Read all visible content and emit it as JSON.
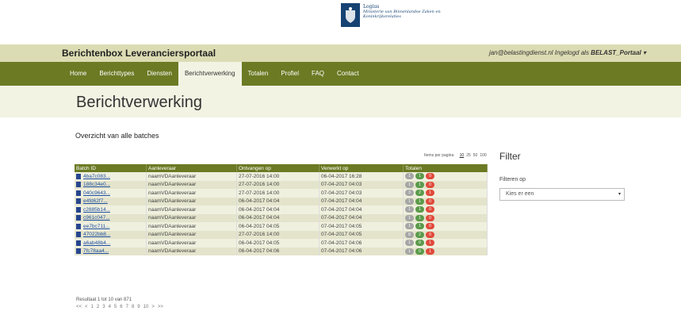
{
  "logo": {
    "line1": "Logius",
    "line2": "Ministerie van Binnenlandse Zaken en",
    "line3": "Koninkrijksrelaties"
  },
  "header": {
    "site_title": "Berichtenbox Leveranciersportaal",
    "user_email": "jan@belastingdienst.nl Ingelogd als ",
    "user_account": "BELAST_Portaal",
    "dropdown_caret": "▾"
  },
  "nav": {
    "items": [
      "Home",
      "Berichttypes",
      "Diensten",
      "Berichtverwerking",
      "Totalen",
      "Profiel",
      "FAQ",
      "Contact"
    ],
    "active": "Berichtverwerking"
  },
  "page": {
    "title": "Berichtverwerking",
    "subtitle": "Overzicht van alle batches"
  },
  "per_page": {
    "label": "Items per pagina",
    "options": [
      "10",
      "25",
      "50",
      "100"
    ],
    "selected": "10"
  },
  "table": {
    "columns": [
      "Batch ID",
      "Aanleveraar",
      "Ontvangen op",
      "Verwerkt op",
      "Totalen"
    ],
    "rows": [
      {
        "id": "4ba7c083...",
        "aanleveraar": "naamVDAanleveraar",
        "ontvangen": "27-07-2016 14:00",
        "verwerkt": "06-04-2017 16:28",
        "t": [
          "1",
          "1",
          "0"
        ]
      },
      {
        "id": "188c34e0...",
        "aanleveraar": "naamVDAanleveraar",
        "ontvangen": "27-07-2016 14:00",
        "verwerkt": "07-04-2017 04:03",
        "t": [
          "1",
          "1",
          "0"
        ]
      },
      {
        "id": "040c9643...",
        "aanleveraar": "naamVDAanleveraar",
        "ontvangen": "27-07-2016 14:00",
        "verwerkt": "07-04-2017 04:03",
        "t": [
          "3",
          "2",
          "1"
        ]
      },
      {
        "id": "e4fd62f7...",
        "aanleveraar": "naamVDAanleveraar",
        "ontvangen": "06-04-2017 04:04",
        "verwerkt": "07-04-2017 04:04",
        "t": [
          "1",
          "1",
          "0"
        ]
      },
      {
        "id": "c2885b14...",
        "aanleveraar": "naamVDAanleveraar",
        "ontvangen": "06-04-2017 04:04",
        "verwerkt": "07-04-2017 04:04",
        "t": [
          "1",
          "1",
          "0"
        ]
      },
      {
        "id": "c961c047...",
        "aanleveraar": "naamVDAanleveraar",
        "ontvangen": "06-04-2017 04:04",
        "verwerkt": "07-04-2017 04:04",
        "t": [
          "1",
          "1",
          "0"
        ]
      },
      {
        "id": "ee7bc711...",
        "aanleveraar": "naamVDAanleveraar",
        "ontvangen": "06-04-2017 04:05",
        "verwerkt": "07-04-2017 04:05",
        "t": [
          "1",
          "1",
          "0"
        ]
      },
      {
        "id": "47022bb8...",
        "aanleveraar": "naamVDAanleveraar",
        "ontvangen": "27-07-2016 14:00",
        "verwerkt": "07-04-2017 04:05",
        "t": [
          "8",
          "2",
          "0"
        ]
      },
      {
        "id": "a6ab48b4...",
        "aanleveraar": "naamVDAanleveraar",
        "ontvangen": "06-04-2017 04:05",
        "verwerkt": "07-04-2017 04:06",
        "t": [
          "1",
          "0",
          "1"
        ]
      },
      {
        "id": "7fc78aa4...",
        "aanleveraar": "naamVDAanleveraar",
        "ontvangen": "06-04-2017 04:06",
        "verwerkt": "07-04-2017 04:06",
        "t": [
          "1",
          "0",
          "1"
        ]
      }
    ]
  },
  "result": "Resultaat 1 tot 10 van 871",
  "pager": {
    "prev": [
      "<<",
      "<"
    ],
    "pages": [
      "1",
      "2",
      "3",
      "4",
      "5",
      "6",
      "7",
      "8",
      "9",
      "10"
    ],
    "next": [
      ">",
      ">>"
    ]
  },
  "filter": {
    "title": "Filter",
    "label": "Filteren op",
    "select_value": "Kies er een",
    "select_arrow": "▾"
  },
  "colors": {
    "nav": "#6b7a23",
    "topbar": "#dcdcb4",
    "titlebar": "#f3f3e4",
    "grey": "#a6a6a6",
    "green": "#5a9a4a",
    "red": "#e04a3c"
  }
}
